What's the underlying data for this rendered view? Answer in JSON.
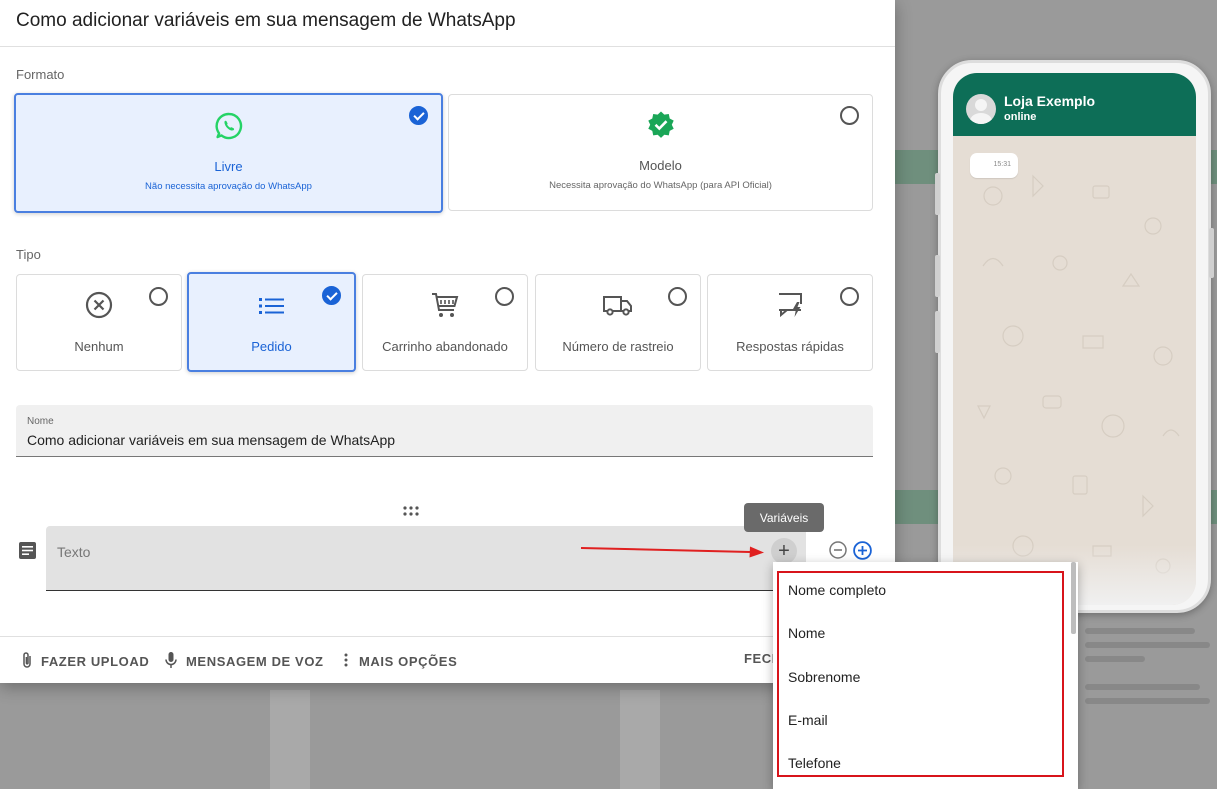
{
  "dialog": {
    "title": "Como adicionar variáveis em sua mensagem de WhatsApp"
  },
  "formato": {
    "label": "Formato",
    "options": [
      {
        "title": "Livre",
        "subtitle": "Não necessita aprovação do WhatsApp",
        "selected": true,
        "icon": "whatsapp-icon"
      },
      {
        "title": "Modelo",
        "subtitle": "Necessita aprovação do WhatsApp (para API Oficial)",
        "selected": false,
        "icon": "verified-badge-icon"
      }
    ]
  },
  "tipo": {
    "label": "Tipo",
    "options": [
      {
        "title": "Nenhum",
        "selected": false,
        "icon": "x-circle-icon"
      },
      {
        "title": "Pedido",
        "selected": true,
        "icon": "list-icon"
      },
      {
        "title": "Carrinho abandonado",
        "selected": false,
        "icon": "cart-icon"
      },
      {
        "title": "Número de rastreio",
        "selected": false,
        "icon": "truck-icon"
      },
      {
        "title": "Respostas rápidas",
        "selected": false,
        "icon": "quick-reply-icon"
      }
    ]
  },
  "name_field": {
    "label": "Nome",
    "value": "Como adicionar variáveis em sua mensagem de WhatsApp"
  },
  "text_field": {
    "placeholder": "Texto"
  },
  "tooltip": {
    "label": "Variáveis"
  },
  "footer": {
    "upload": "FAZER UPLOAD",
    "voice": "MENSAGEM DE VOZ",
    "more": "MAIS OPÇÕES",
    "close": "FECH"
  },
  "variables_menu": {
    "items": [
      "Nome completo",
      "Nome",
      "Sobrenome",
      "E-mail",
      "Telefone"
    ]
  },
  "preview": {
    "contact_name": "Loja Exemplo",
    "status": "online",
    "bubble_time": "15:31"
  },
  "colors": {
    "accent": "#1a63d6",
    "whatsapp_green": "#25d366",
    "header_green": "#0d6e57",
    "highlight_red": "#d8141b"
  }
}
